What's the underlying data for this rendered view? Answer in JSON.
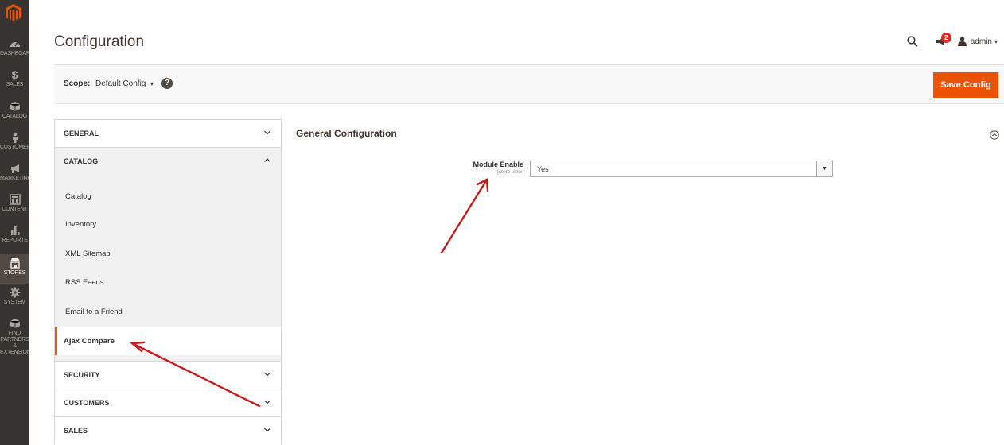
{
  "nav": {
    "items": [
      {
        "label": "DASHBOARD",
        "icon": "gauge-icon"
      },
      {
        "label": "SALES",
        "icon": "dollar-icon"
      },
      {
        "label": "CATALOG",
        "icon": "cube-icon"
      },
      {
        "label": "CUSTOMERS",
        "icon": "person-icon"
      },
      {
        "label": "MARKETING",
        "icon": "megaphone-icon"
      },
      {
        "label": "CONTENT",
        "icon": "layout-icon"
      },
      {
        "label": "REPORTS",
        "icon": "bar-chart-icon"
      },
      {
        "label": "STORES",
        "icon": "store-icon",
        "active": true
      },
      {
        "label": "SYSTEM",
        "icon": "gear-icon"
      },
      {
        "label": "FIND PARTNERS & EXTENSIONS",
        "icon": "box-icon"
      }
    ]
  },
  "header": {
    "title": "Configuration",
    "notifications_count": "2",
    "user": "admin"
  },
  "scope": {
    "label": "Scope:",
    "value": "Default Config",
    "help": "?"
  },
  "actions": {
    "save": "Save Config"
  },
  "sidebar": {
    "general": "GENERAL",
    "catalog": "CATALOG",
    "catalog_items": [
      "Catalog",
      "Inventory",
      "XML Sitemap",
      "RSS Feeds",
      "Email to a Friend",
      "Ajax Compare"
    ],
    "security": "SECURITY",
    "customers": "CUSTOMERS",
    "sales": "SALES"
  },
  "section": {
    "title": "General Configuration",
    "field_label": "Module Enable",
    "field_scope": "[store view]",
    "field_value": "Yes"
  },
  "colors": {
    "nav_bg": "#373330",
    "accent": "#eb5202",
    "annotation_arrow": "#c41c1c"
  }
}
